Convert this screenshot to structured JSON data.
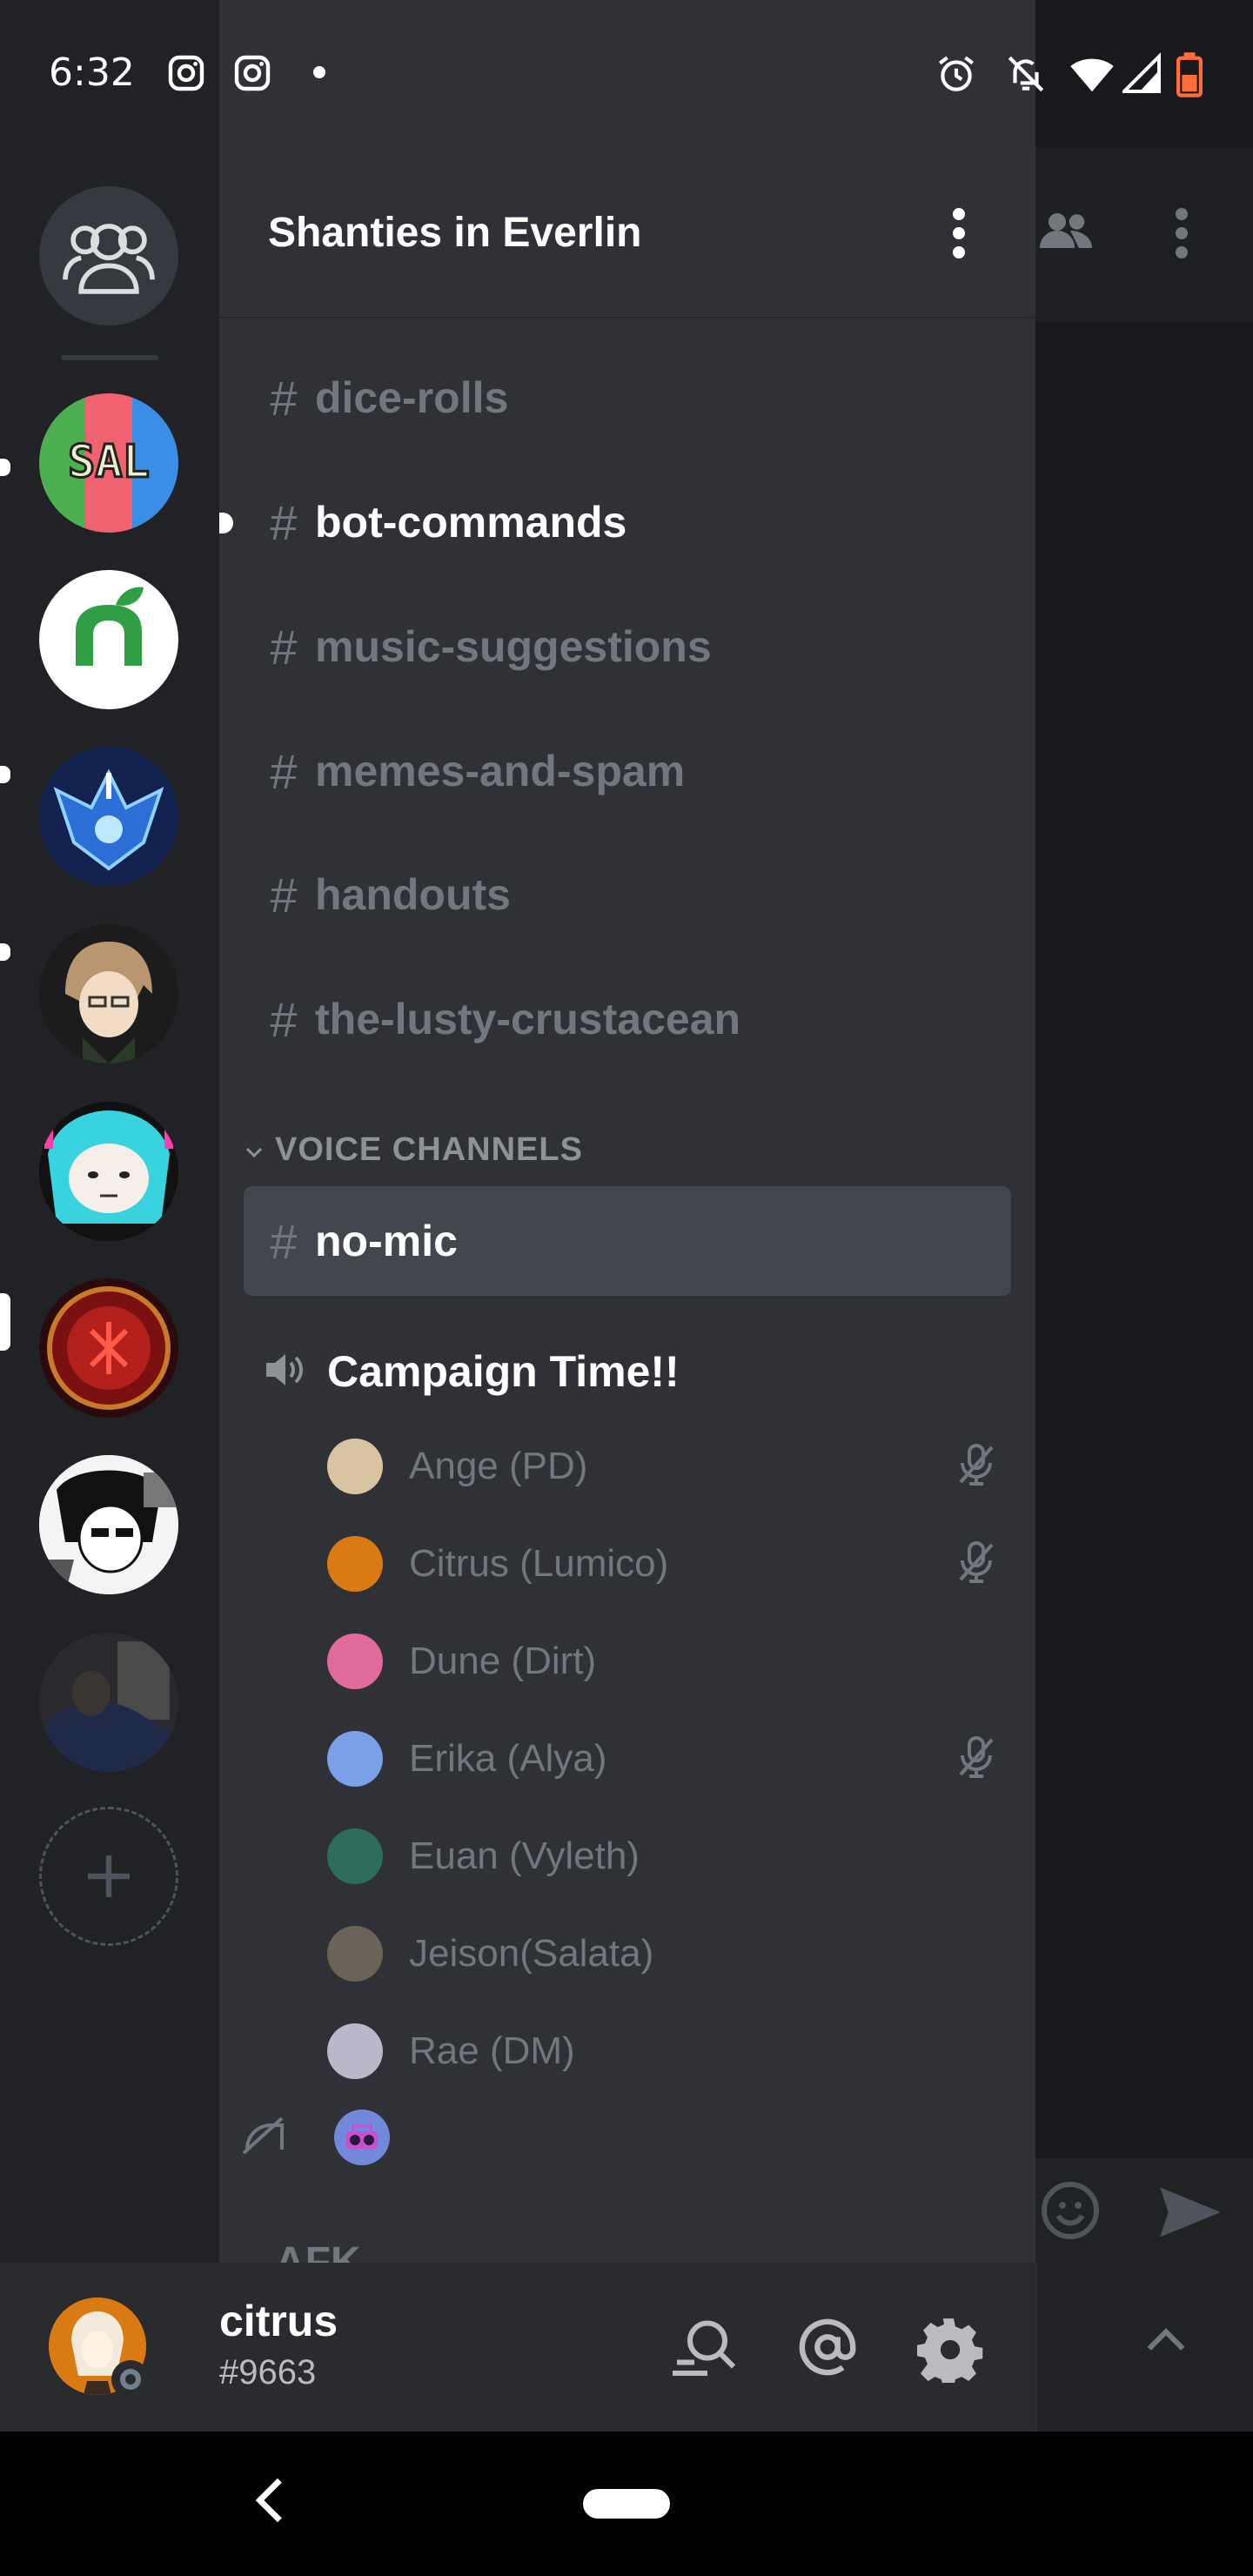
{
  "status_bar": {
    "time": "6:32",
    "left_icons": [
      "instagram-icon",
      "instagram-icon",
      "notification-dot"
    ],
    "right_icons": [
      "alarm-icon",
      "bell-off-icon",
      "wifi-icon",
      "signal-icon",
      "battery-icon"
    ]
  },
  "server": {
    "name": "Shanties in Everlin",
    "menu_icon": "kebab-menu-icon"
  },
  "server_rail": {
    "items": [
      {
        "name": "SAL",
        "colors": [
          "#4caf50",
          "#f06270",
          "#3a8ee6"
        ]
      },
      {
        "name": "leaf-n",
        "colors": [
          "#ffffff",
          "#2f9e44"
        ]
      },
      {
        "name": "blue-crest",
        "colors": [
          "#12214d",
          "#47a9ff"
        ]
      },
      {
        "name": "anime-boy",
        "colors": [
          "#1c1c1c",
          "#c9a27a"
        ]
      },
      {
        "name": "teal-hair",
        "colors": [
          "#111111",
          "#39d3e0"
        ]
      },
      {
        "name": "red-sigil",
        "colors": [
          "#3a0b0b",
          "#c0392b"
        ]
      },
      {
        "name": "manga-girl",
        "colors": [
          "#ffffff",
          "#111111"
        ]
      },
      {
        "name": "photo",
        "colors": [
          "#1a2336",
          "#4a5468"
        ]
      }
    ]
  },
  "channels": [
    {
      "label": "dice-rolls",
      "state": "muted"
    },
    {
      "label": "bot-commands",
      "state": "unread"
    },
    {
      "label": "music-suggestions",
      "state": "muted"
    },
    {
      "label": "memes-and-spam",
      "state": "muted"
    },
    {
      "label": "handouts",
      "state": "muted"
    },
    {
      "label": "the-lusty-crustacean",
      "state": "muted"
    }
  ],
  "voice_category": {
    "label": "VOICE CHANNELS",
    "text_channel": "no-mic",
    "voice_channel": "Campaign Time!!"
  },
  "voice_users": [
    {
      "name": "Ange (PD)",
      "muted": true,
      "color": "#d8c4a0"
    },
    {
      "name": "Citrus (Lumico)",
      "muted": true,
      "color": "#d97a12"
    },
    {
      "name": "Dune (Dirt)",
      "muted": false,
      "color": "#e06a9a"
    },
    {
      "name": "Erika (Alya)",
      "muted": true,
      "color": "#7aa0e8"
    },
    {
      "name": "Euan (Vyleth)",
      "muted": false,
      "color": "#2d6b5a"
    },
    {
      "name": "Jeison(Salata)",
      "muted": false,
      "color": "#6b6258"
    },
    {
      "name": "Rae (DM)",
      "muted": false,
      "color": "#b8b8c8"
    }
  ],
  "cut_off_category": "AFK",
  "user": {
    "name": "citrus",
    "tag": "#9663"
  },
  "colors": {
    "rail_bg": "#202225",
    "panel_bg": "#2f3136",
    "muted_text": "#72767d",
    "active_bg": "#42464d",
    "blurple": "#7289da"
  }
}
